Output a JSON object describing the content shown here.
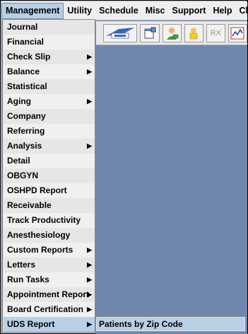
{
  "menubar": {
    "items": [
      {
        "label": "Management"
      },
      {
        "label": "Utility"
      },
      {
        "label": "Schedule"
      },
      {
        "label": "Misc"
      },
      {
        "label": "Support"
      },
      {
        "label": "Help"
      },
      {
        "label": "Cli"
      }
    ]
  },
  "toolbar": {
    "rx_label": "RX"
  },
  "menu": {
    "items": [
      {
        "label": "Journal"
      },
      {
        "label": "Financial"
      },
      {
        "label": "Check Slip"
      },
      {
        "label": "Balance"
      },
      {
        "label": "Statistical"
      },
      {
        "label": "Aging"
      },
      {
        "label": "Company"
      },
      {
        "label": "Referring"
      },
      {
        "label": "Analysis"
      },
      {
        "label": "Detail"
      },
      {
        "label": "OBGYN"
      },
      {
        "label": "OSHPD Report"
      },
      {
        "label": "Receivable"
      },
      {
        "label": "Track Productivity"
      },
      {
        "label": "Anesthesiology"
      },
      {
        "label": "Custom Reports"
      },
      {
        "label": "Letters"
      },
      {
        "label": "Run Tasks"
      },
      {
        "label": "Appointment Report"
      },
      {
        "label": "Board Certification"
      },
      {
        "label": "UDS Report"
      }
    ]
  },
  "submenu": {
    "items": [
      {
        "label": "Patients by Zip Code"
      }
    ]
  },
  "colors": {
    "highlight": "#b8cfe5",
    "desktop": "#6f87ad",
    "menu_bg": "#e6e6e6"
  }
}
